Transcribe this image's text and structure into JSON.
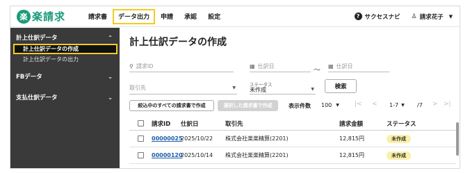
{
  "app": {
    "logo_mark": "楽",
    "logo_text": "楽請求"
  },
  "nav": {
    "items": [
      "請求書",
      "データ出力",
      "申請",
      "承認",
      "設定"
    ],
    "help_label": "サクセスナビ",
    "user_name": "請求花子"
  },
  "sidebar": {
    "sections": [
      {
        "label": "計上仕訳データ",
        "expanded": true
      },
      {
        "label": "FBデータ",
        "expanded": false
      },
      {
        "label": "支払仕訳データ",
        "expanded": false
      }
    ],
    "sub_items": [
      "計上仕訳データの作成",
      "計上仕訳データの出力"
    ]
  },
  "main": {
    "title": "計上仕訳データの作成",
    "search_placeholder": "請求ID",
    "date_from_placeholder": "仕訳日",
    "date_to_placeholder": "仕訳日",
    "date_separator": "〜",
    "client_placeholder": "取引先",
    "status_label": "ステータス",
    "status_value": "未作成",
    "search_button": "検索",
    "create_all_button": "絞込中のすべての請求書で作成",
    "create_selected_button": "選択した請求書で作成",
    "page_size_label": "表示件数",
    "page_size_value": "100",
    "page_range": "1-7",
    "page_total": "/7"
  },
  "table": {
    "headers": [
      "請求ID",
      "仕訳日",
      "取引先",
      "請求金額",
      "ステータス"
    ],
    "rows": [
      {
        "id": "00000025",
        "date": "2025/10/22",
        "client": "株式会社楽楽精算(2201)",
        "amount": "12,815円",
        "status": "未作成"
      },
      {
        "id": "00000120",
        "date": "2025/10/14",
        "client": "株式会社楽楽精算(2201)",
        "amount": "12,815円",
        "status": "未作成"
      }
    ]
  },
  "colors": {
    "brand": "#1a9a7a",
    "highlight": "#f2cc1d",
    "sidebar_bg": "#3a3a3a",
    "link": "#1a5fa8",
    "badge_bg": "#faf0a8"
  }
}
